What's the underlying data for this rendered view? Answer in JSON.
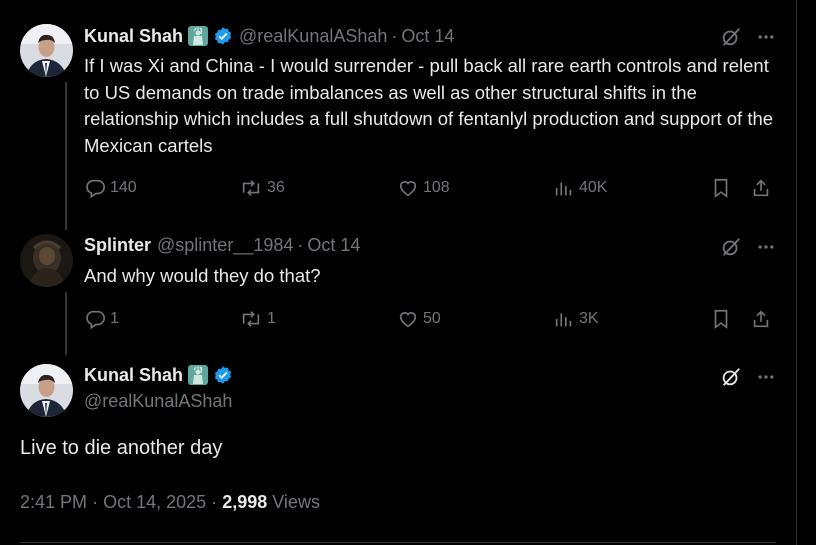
{
  "tweets": [
    {
      "name": "Kunal Shah",
      "handle": "@realKunalAShah",
      "separator": "·",
      "date": "Oct 14",
      "text": "If I was Xi and China - I would surrender - pull back all rare earth controls and relent to US demands on trade imbalances as well as other structural shifts in the relationship which includes a full shutdown of fentanlyl production and support of the Mexican cartels",
      "replies": "140",
      "reposts": "36",
      "likes": "108",
      "views": "40K"
    },
    {
      "name": "Splinter",
      "handle": "@splinter__1984",
      "separator": "·",
      "date": "Oct 14",
      "text": "And why would they do that?",
      "replies": "1",
      "reposts": "1",
      "likes": "50",
      "views": "3K"
    }
  ],
  "main_tweet": {
    "name": "Kunal Shah",
    "handle": "@realKunalAShah",
    "text": "Live to die another day",
    "time": "2:41 PM",
    "separator": "·",
    "date": "Oct 14, 2025",
    "views_count": "2,998",
    "views_label": "Views"
  },
  "colors": {
    "background": "#000000",
    "text": "#e7e9ea",
    "muted": "#71767b",
    "verified": "#1d9bf0",
    "thread_line": "#333639"
  },
  "icons": [
    "liberty-emoji-icon",
    "verified-badge-icon",
    "grok-icon",
    "more-icon",
    "reply-icon",
    "repost-icon",
    "like-icon",
    "views-icon",
    "bookmark-icon",
    "share-icon"
  ]
}
